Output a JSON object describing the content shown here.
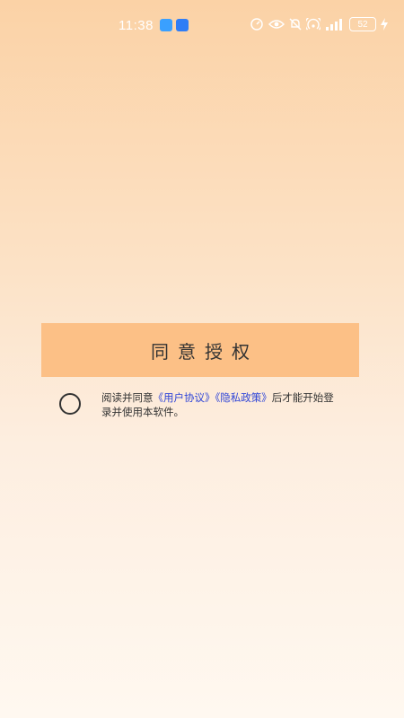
{
  "status_bar": {
    "time": "11:38",
    "battery": "52",
    "icons": [
      "app-notification-icon",
      "app-notification-icon",
      "hd-icon",
      "eye-icon",
      "mute-icon",
      "hotspot-icon",
      "signal-icon",
      "battery-icon",
      "charging-icon"
    ]
  },
  "auth": {
    "button_label": "同意授权"
  },
  "agreement": {
    "prefix": "阅读并同意",
    "user_agreement_link": "《用户协议》",
    "privacy_policy_link": "《隐私政策》",
    "suffix": "后才能开始登录并使用本软件。"
  },
  "colors": {
    "accent_button": "#fcc086",
    "link": "#2f45d8",
    "text": "#333333"
  }
}
